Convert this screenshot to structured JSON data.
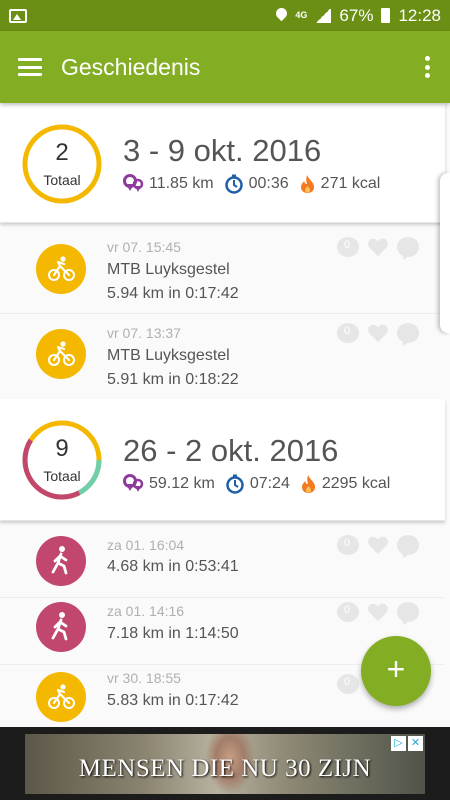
{
  "status_bar": {
    "network": "4G",
    "battery": "67%",
    "time": "12:28"
  },
  "app_bar": {
    "title": "Geschiedenis"
  },
  "weeks": [
    {
      "count": "2",
      "count_label": "Totaal",
      "title": "3 - 9 okt. 2016",
      "distance": "11.85 km",
      "duration": "00:36",
      "calories": "271 kcal",
      "activities": [
        {
          "type": "bike",
          "date": "vr 07. 15:45",
          "name": "MTB Luyksgestel",
          "metric": "5.94 km in 0:17:42"
        },
        {
          "type": "bike",
          "date": "vr 07. 13:37",
          "name": "MTB Luyksgestel",
          "metric": "5.91 km in 0:18:22"
        }
      ]
    },
    {
      "count": "9",
      "count_label": "Totaal",
      "title": "26 - 2 okt. 2016",
      "distance": "59.12 km",
      "duration": "07:24",
      "calories": "2295 kcal",
      "activities": [
        {
          "type": "walk",
          "date": "za 01. 16:04",
          "name": "",
          "metric": "4.68 km in 0:53:41"
        },
        {
          "type": "walk",
          "date": "za 01. 14:16",
          "name": "",
          "metric": "7.18 km in 1:14:50"
        },
        {
          "type": "bike",
          "date": "vr 30. 18:55",
          "name": "",
          "metric": "5.83 km in 0:17:42"
        }
      ]
    }
  ],
  "fab": {
    "label": "+"
  },
  "ad": {
    "text": "MENSEN DIE NU 30 ZIJN",
    "choices_icon": "▷",
    "close_icon": "✕"
  },
  "colors": {
    "app_bar": "#83ae24",
    "status_bar": "#6a8f14",
    "bike": "#f4b800",
    "walk": "#c1476e",
    "distance_icon": "#8d3c9c",
    "duration_icon": "#1f5fa8",
    "calories_icon": "#f37a20"
  }
}
